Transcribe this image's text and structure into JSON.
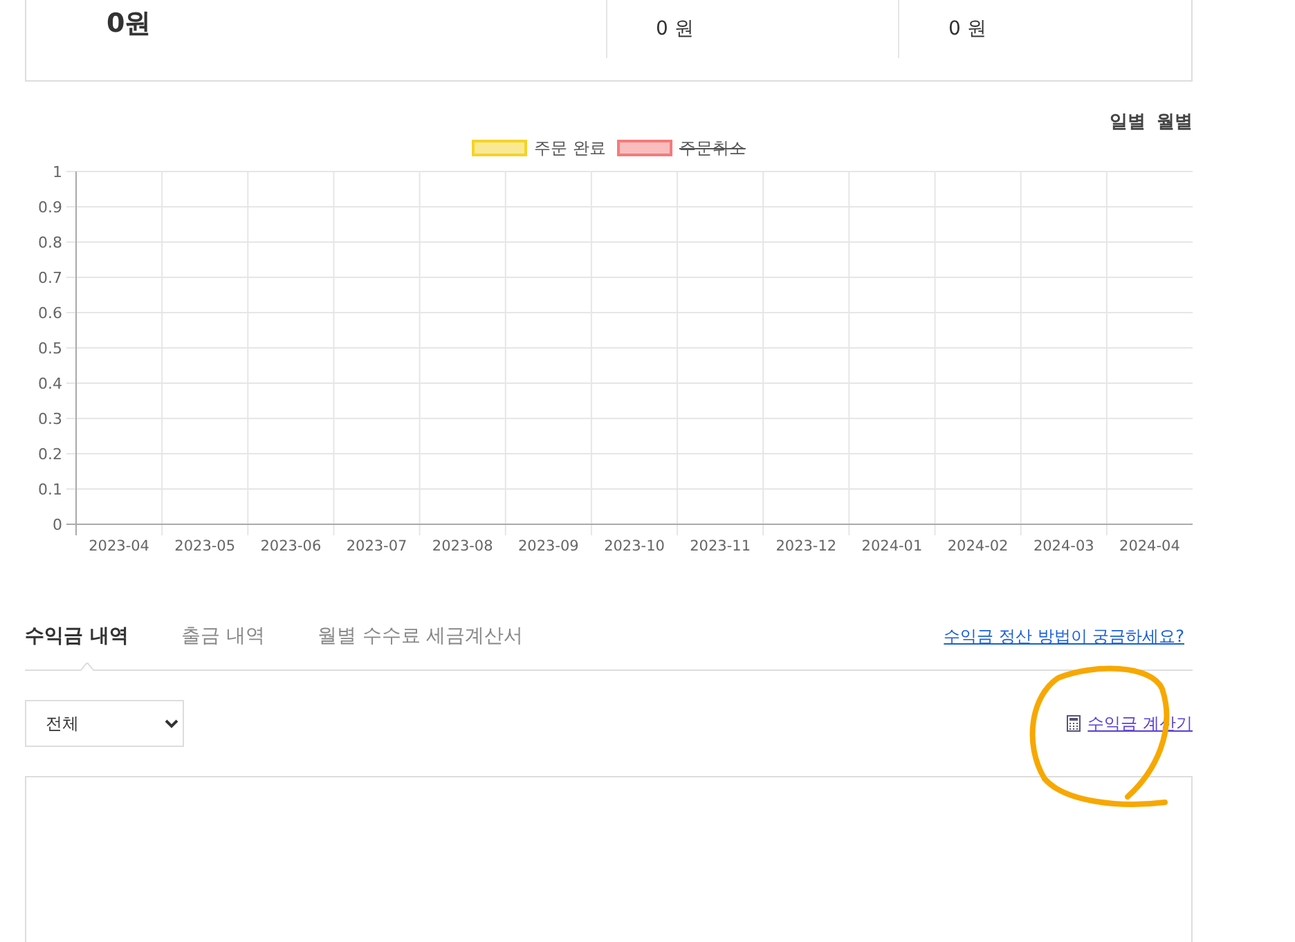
{
  "summary": {
    "total": "0원",
    "items": [
      {
        "value": "0 원"
      },
      {
        "value": "0 원"
      }
    ]
  },
  "period_toggle": [
    {
      "label": "일별"
    },
    {
      "label": "월별"
    }
  ],
  "chart": {
    "chart_data": {
      "type": "bar",
      "categories": [
        "2023-04",
        "2023-05",
        "2023-06",
        "2023-07",
        "2023-08",
        "2023-09",
        "2023-10",
        "2023-11",
        "2023-12",
        "2024-01",
        "2024-02",
        "2024-03",
        "2024-04"
      ],
      "series": [
        {
          "name": "주문 완료",
          "color": "#f5d327",
          "values": [
            null,
            null,
            null,
            null,
            null,
            null,
            null,
            null,
            null,
            null,
            null,
            null,
            null
          ]
        },
        {
          "name": "주문취소",
          "color": "#f47b7b",
          "values": [
            null,
            null,
            null,
            null,
            null,
            null,
            null,
            null,
            null,
            null,
            null,
            null,
            null
          ]
        }
      ],
      "ylim": [
        0,
        1
      ],
      "yticks": [
        0,
        0.1,
        0.2,
        0.3,
        0.4,
        0.5,
        0.6,
        0.7,
        0.8,
        0.9,
        1
      ],
      "grid": true
    },
    "legend": [
      {
        "hidden": false
      },
      {
        "hidden": true
      }
    ]
  },
  "tabs": [
    {
      "label": "수익금 내역",
      "selected": true
    },
    {
      "label": "출금 내역",
      "selected": false
    },
    {
      "label": "월별 수수료 세금계산서",
      "selected": false
    }
  ],
  "help_link": "수익금 정산 방법이 궁금하세요?",
  "filter_select": {
    "value": "전체"
  },
  "calculator_link": "수익금 계산기"
}
